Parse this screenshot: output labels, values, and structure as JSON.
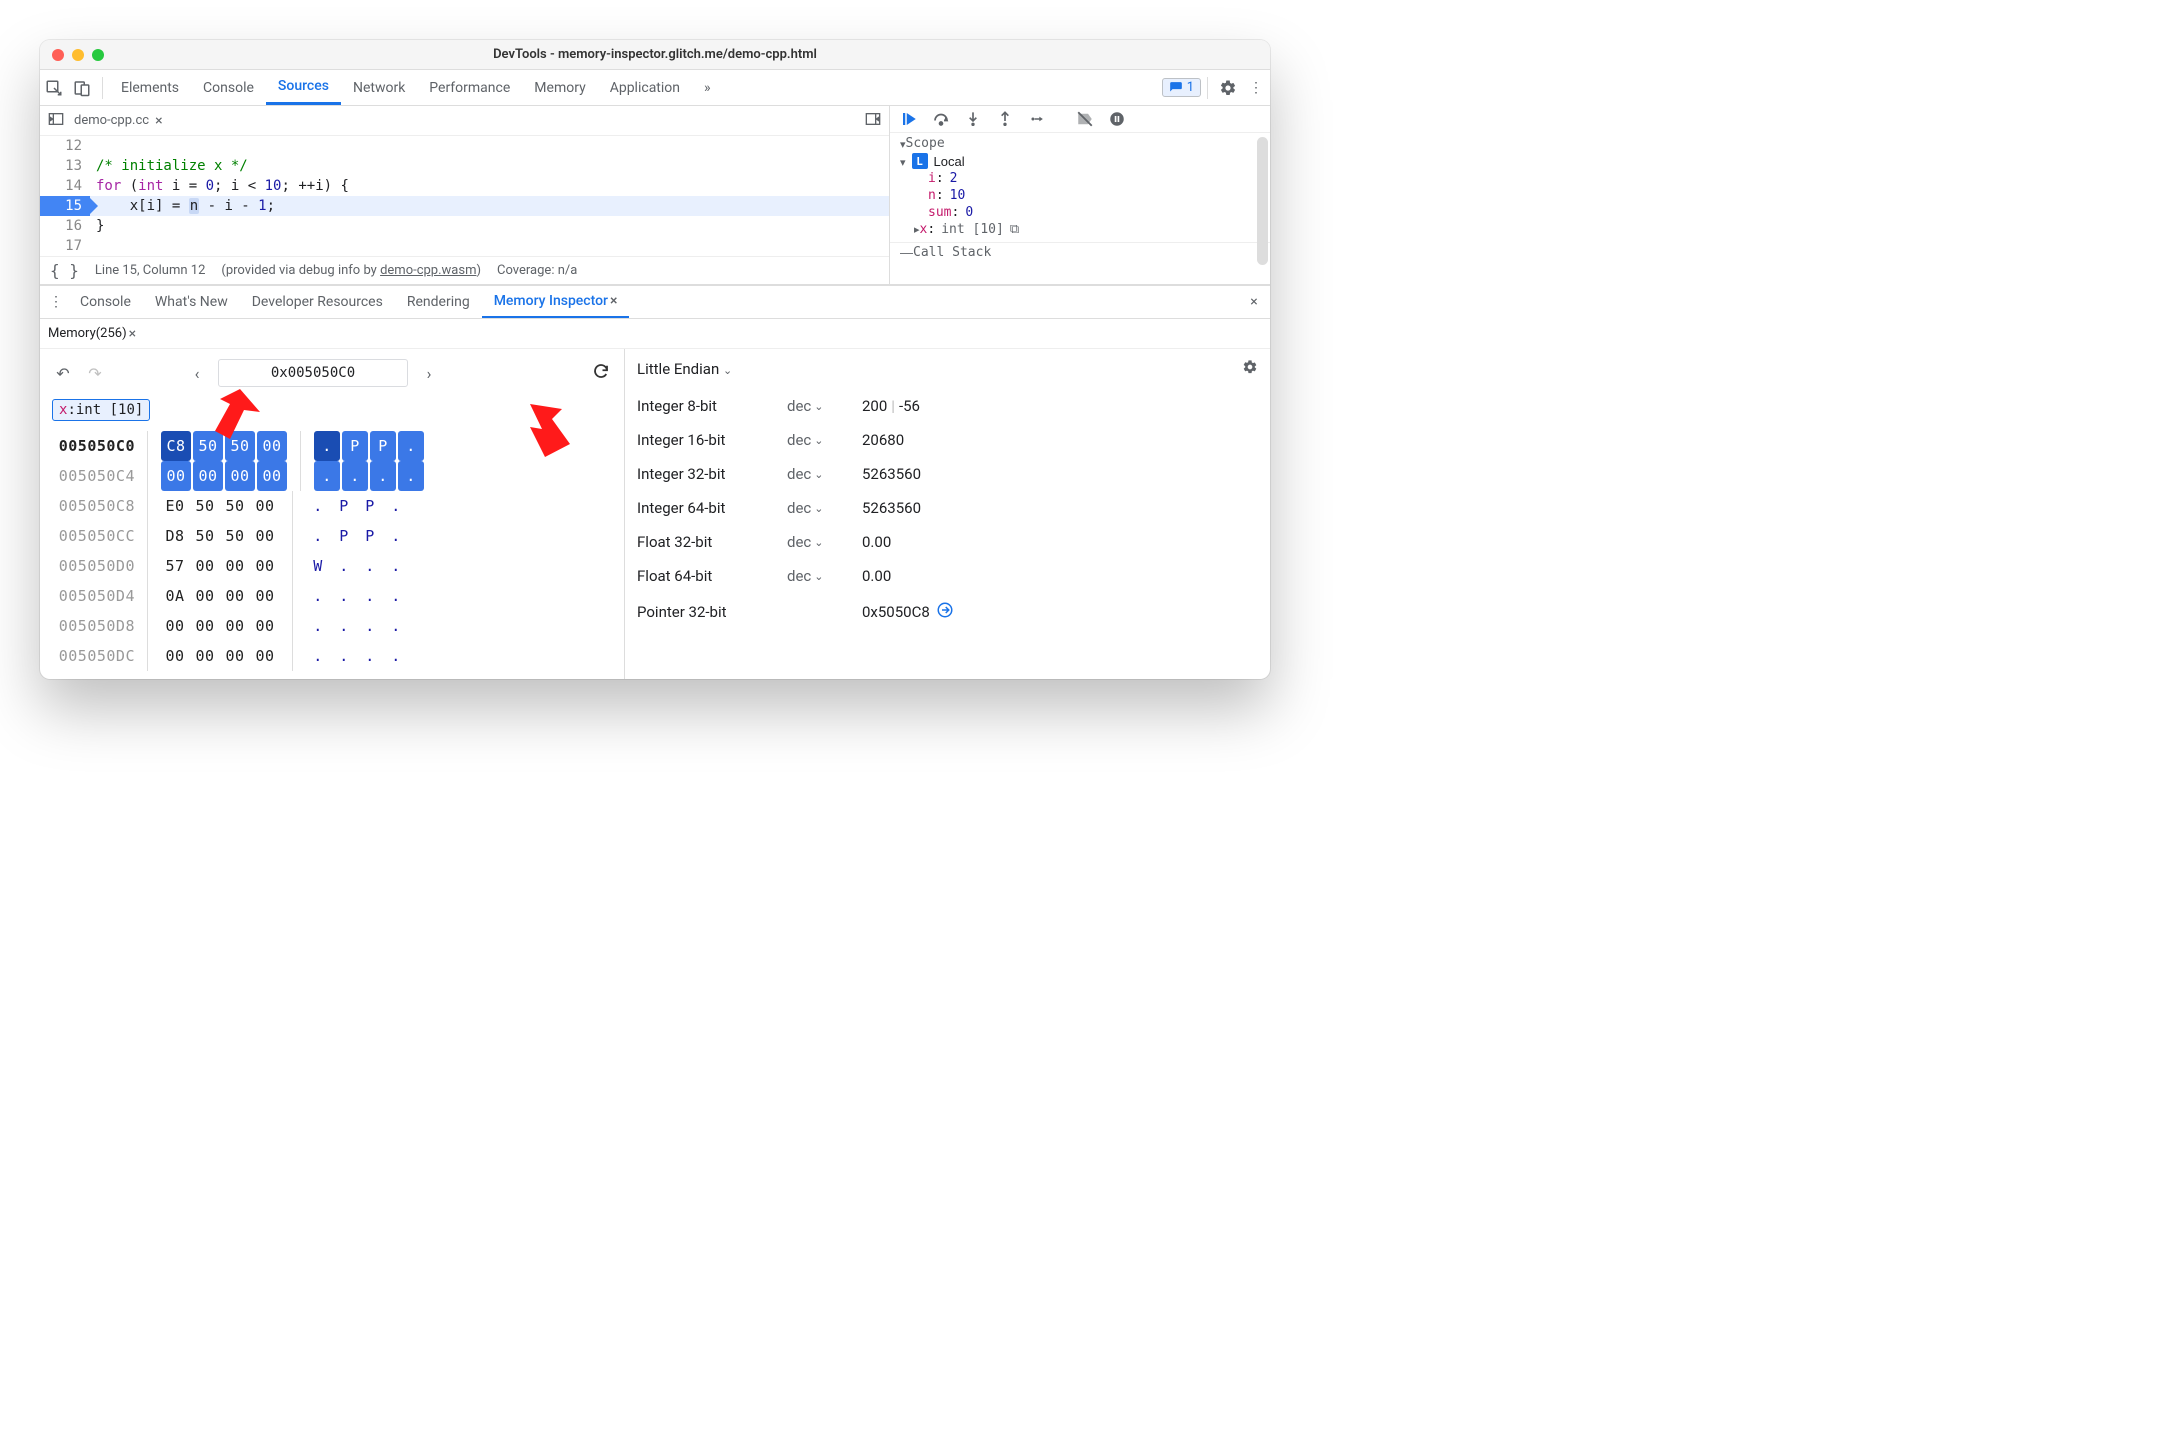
{
  "window": {
    "title": "DevTools - memory-inspector.glitch.me/demo-cpp.html"
  },
  "mainTabs": {
    "items": [
      "Elements",
      "Console",
      "Sources",
      "Network",
      "Performance",
      "Memory",
      "Application"
    ],
    "active": "Sources",
    "errorsBadge": "1"
  },
  "fileTab": {
    "name": "demo-cpp.cc"
  },
  "statusBar": {
    "pos": "Line 15, Column 12",
    "debugInfo_pre": "(provided via debug info by ",
    "debugInfo_link": "demo-cpp.wasm",
    "debugInfo_post": ")",
    "coverage": "Coverage: n/a"
  },
  "code": {
    "lines": [
      {
        "n": 12,
        "html": ""
      },
      {
        "n": 13,
        "html": "<span class='cmt'>/* initialize x */</span>"
      },
      {
        "n": 14,
        "html": "<span class='kw'>for</span> (<span class='type'>int</span> i = <span class='num'>0</span>; i &lt; <span class='num'>10</span>; ++i) {"
      },
      {
        "n": 15,
        "html": "    x[i] = <span class='hl-n'>n</span> - i - <span class='num'>1</span>;",
        "current": true
      },
      {
        "n": 16,
        "html": "}"
      },
      {
        "n": 17,
        "html": ""
      }
    ]
  },
  "scope": {
    "title": "Scope",
    "localLabel": "Local",
    "vars": [
      {
        "name": "i",
        "value": "2"
      },
      {
        "name": "n",
        "value": "10"
      },
      {
        "name": "sum",
        "value": "0"
      },
      {
        "name": "x",
        "type": "int [10]",
        "expandable": true,
        "memoryIcon": true
      }
    ],
    "callStackLabel": "Call Stack"
  },
  "drawer": {
    "tabs": [
      "Console",
      "What's New",
      "Developer Resources",
      "Rendering",
      "Memory Inspector"
    ],
    "active": "Memory Inspector"
  },
  "memoryTab": {
    "label": "Memory(256)"
  },
  "mi": {
    "address": "0x005050C0",
    "chip": {
      "name": "x",
      "type": "int [10]"
    },
    "hex": [
      {
        "addr": "005050C0",
        "bold": true,
        "bytes": [
          "C8",
          "50",
          "50",
          "00"
        ],
        "ascii": [
          ".",
          "P",
          "P",
          "."
        ],
        "sel": "primary"
      },
      {
        "addr": "005050C4",
        "bytes": [
          "00",
          "00",
          "00",
          "00"
        ],
        "ascii": [
          ".",
          ".",
          ".",
          "."
        ],
        "sel": "secondary"
      },
      {
        "addr": "005050C8",
        "bytes": [
          "E0",
          "50",
          "50",
          "00"
        ],
        "ascii": [
          ".",
          "P",
          "P",
          "."
        ]
      },
      {
        "addr": "005050CC",
        "bytes": [
          "D8",
          "50",
          "50",
          "00"
        ],
        "ascii": [
          ".",
          "P",
          "P",
          "."
        ]
      },
      {
        "addr": "005050D0",
        "bytes": [
          "57",
          "00",
          "00",
          "00"
        ],
        "ascii": [
          "W",
          ".",
          ".",
          "."
        ]
      },
      {
        "addr": "005050D4",
        "bytes": [
          "0A",
          "00",
          "00",
          "00"
        ],
        "ascii": [
          ".",
          ".",
          ".",
          "."
        ]
      },
      {
        "addr": "005050D8",
        "bytes": [
          "00",
          "00",
          "00",
          "00"
        ],
        "ascii": [
          ".",
          ".",
          ".",
          "."
        ]
      },
      {
        "addr": "005050DC",
        "bytes": [
          "00",
          "00",
          "00",
          "00"
        ],
        "ascii": [
          ".",
          ".",
          ".",
          "."
        ]
      }
    ],
    "endianness": "Little Endian",
    "values": [
      {
        "label": "Integer 8-bit",
        "fmt": "dec",
        "val": "200 | -56",
        "split": true
      },
      {
        "label": "Integer 16-bit",
        "fmt": "dec",
        "val": "20680"
      },
      {
        "label": "Integer 32-bit",
        "fmt": "dec",
        "val": "5263560"
      },
      {
        "label": "Integer 64-bit",
        "fmt": "dec",
        "val": "5263560"
      },
      {
        "label": "Float 32-bit",
        "fmt": "dec",
        "val": "0.00"
      },
      {
        "label": "Float 64-bit",
        "fmt": "dec",
        "val": "0.00"
      },
      {
        "label": "Pointer 32-bit",
        "fmt": "",
        "val": "0x5050C8",
        "pointer": true
      }
    ]
  }
}
